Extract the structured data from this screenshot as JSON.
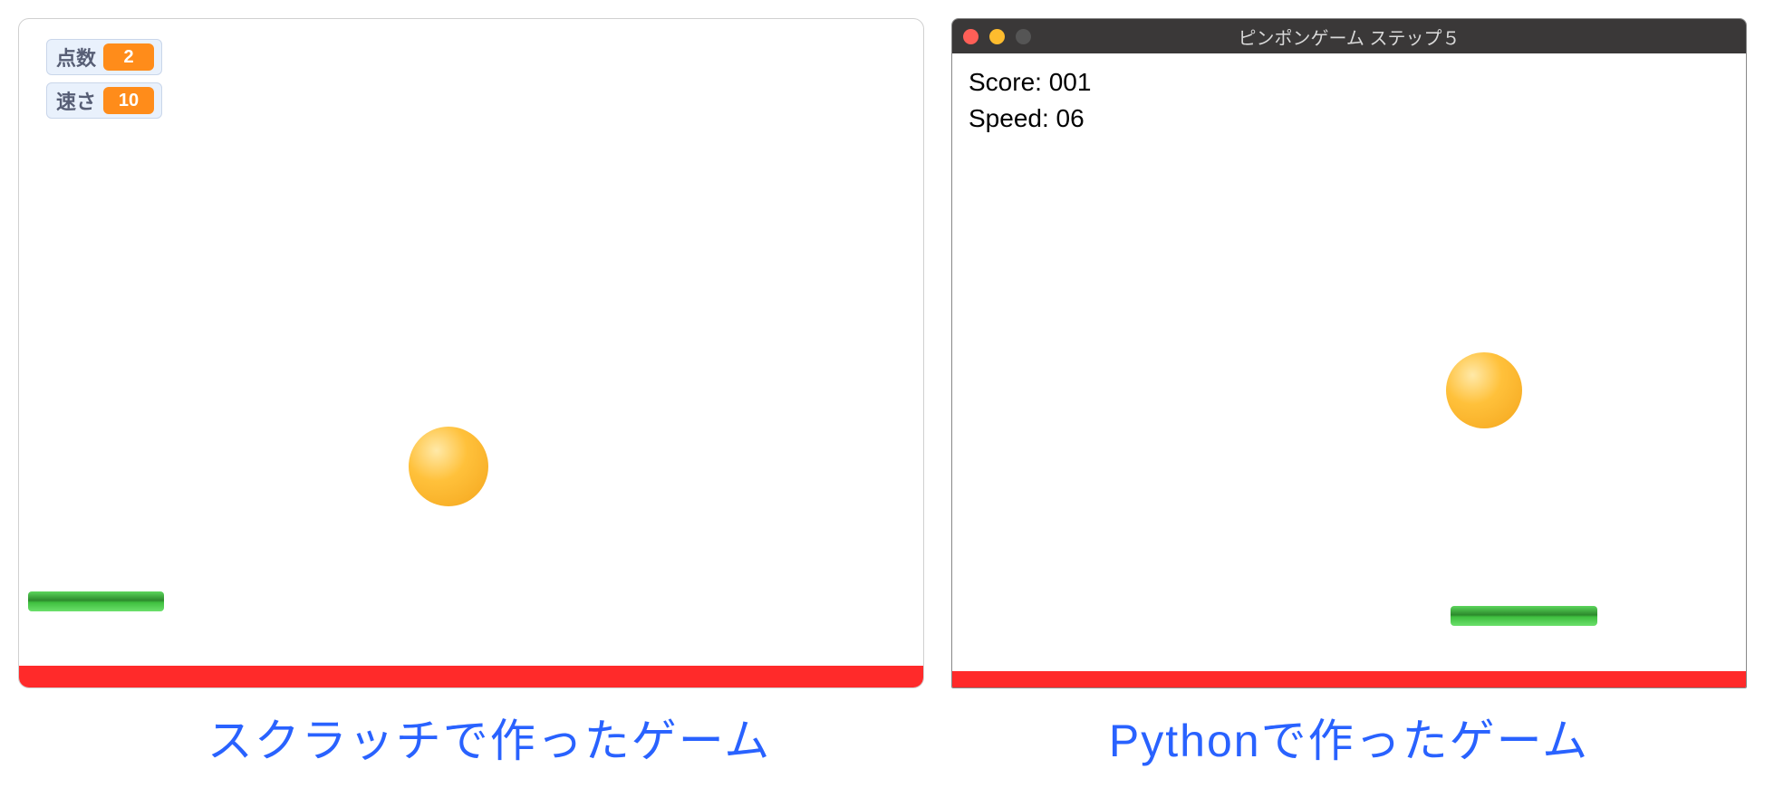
{
  "scratch": {
    "variables": {
      "score_label": "点数",
      "score_value": "2",
      "speed_label": "速さ",
      "speed_value": "10"
    },
    "caption": "スクラッチで作ったゲーム"
  },
  "python": {
    "window_title": "ピンポンゲーム ステップ５",
    "score_line": "Score: 001",
    "speed_line": "Speed:  06",
    "caption": "Pythonで作ったゲーム"
  },
  "traffic_lights": {
    "close": "close-icon",
    "minimize": "minimize-icon",
    "maximize": "maximize-icon"
  }
}
